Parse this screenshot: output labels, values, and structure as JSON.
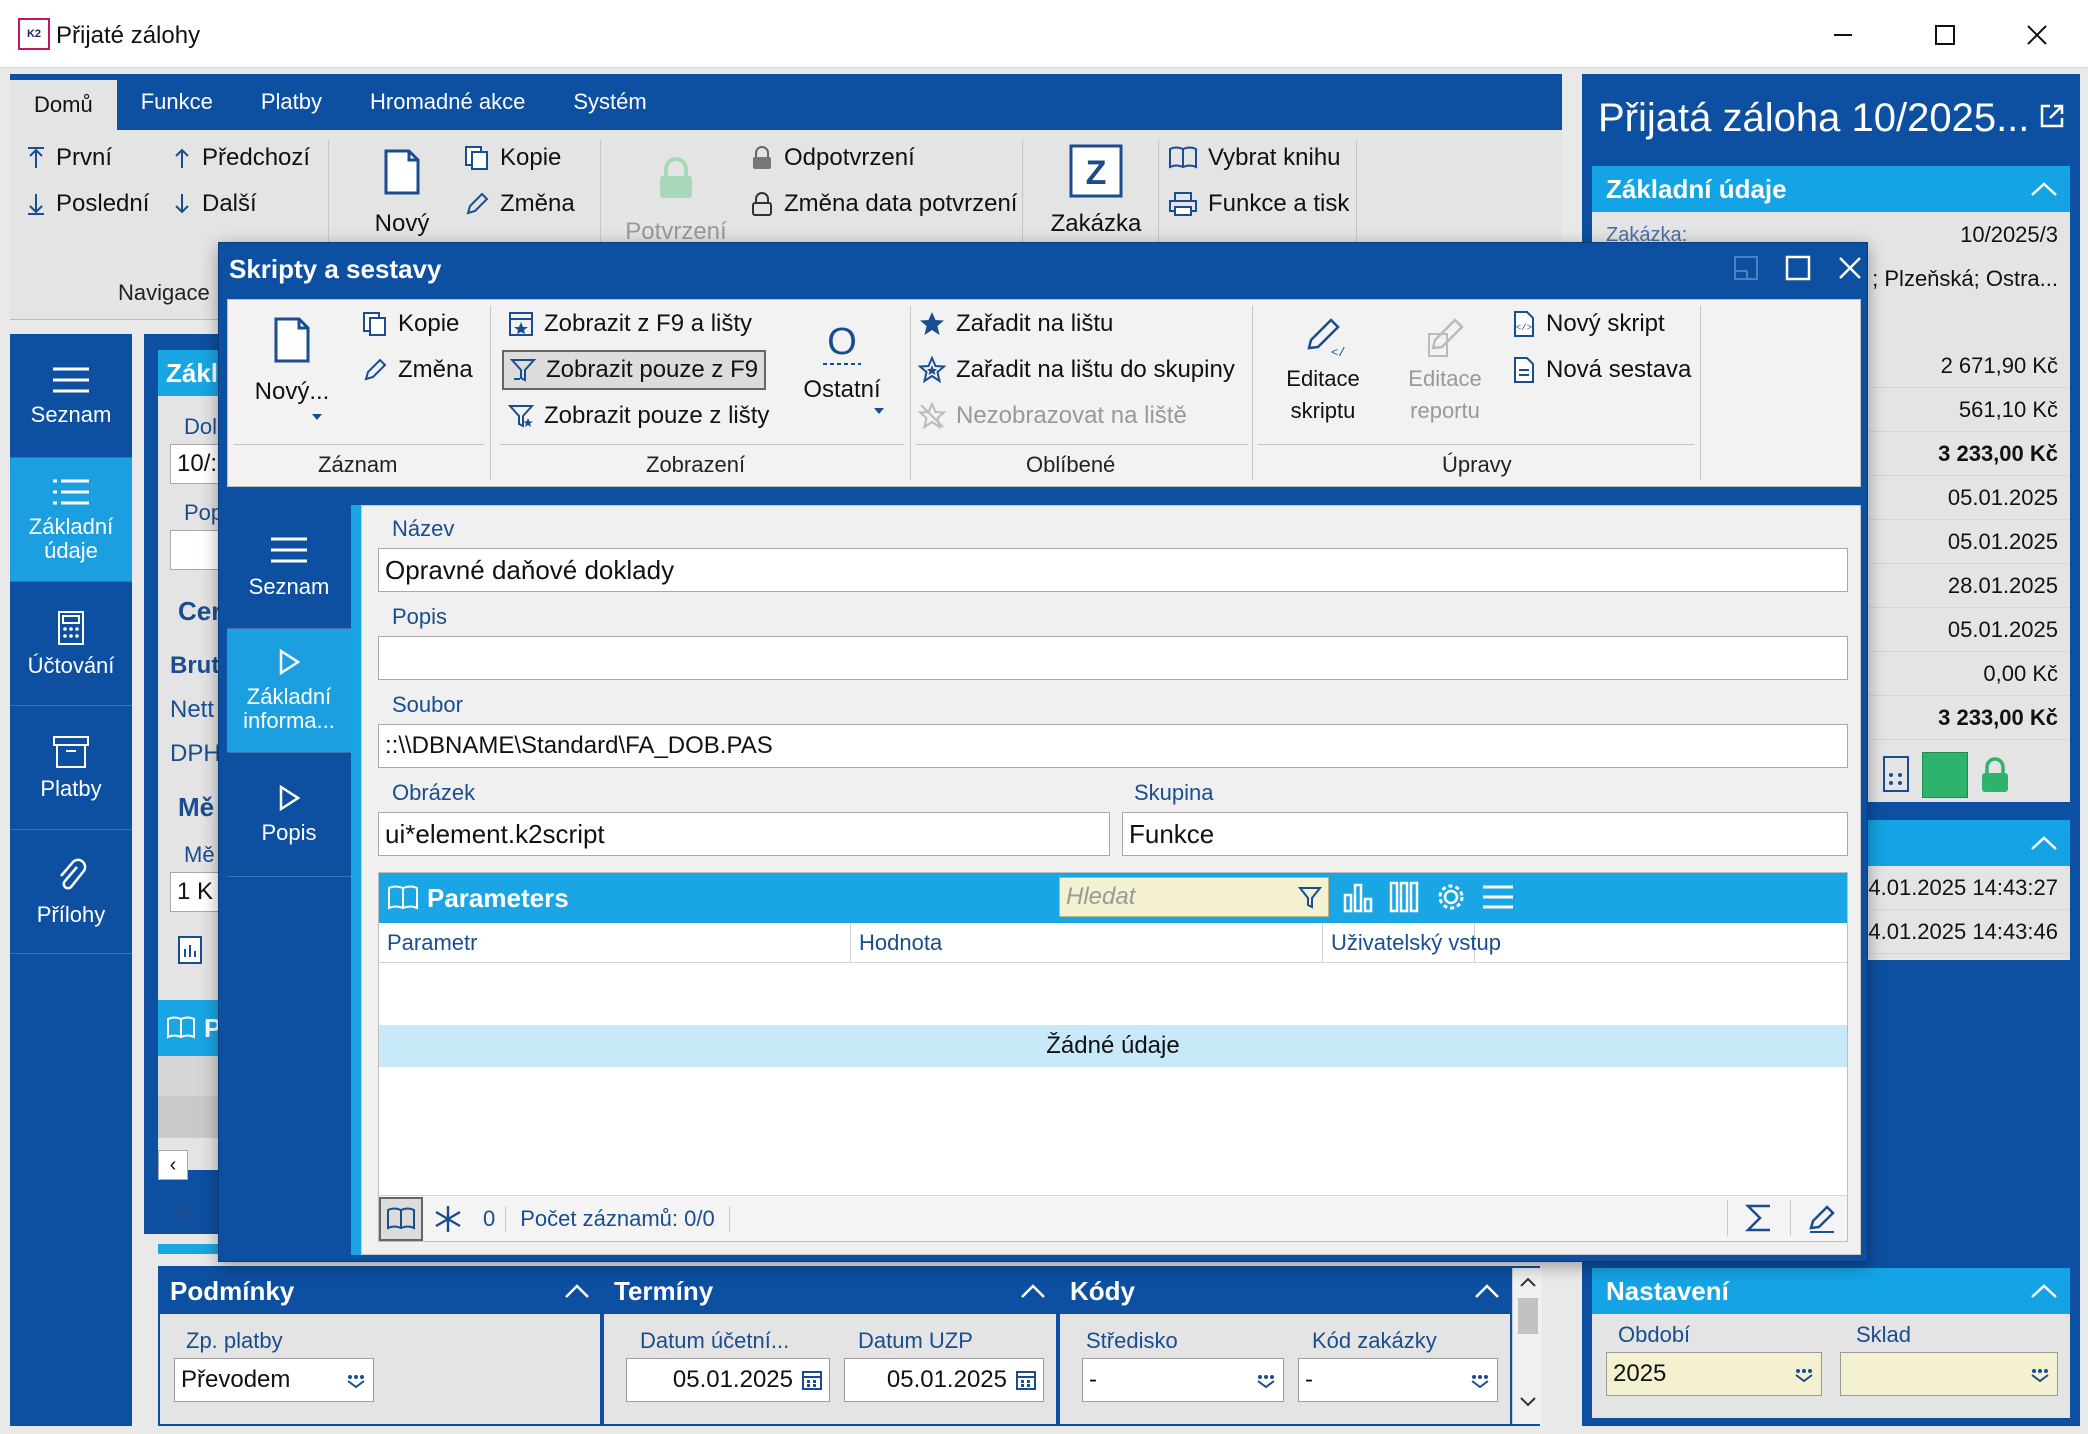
{
  "window": {
    "title": "Přijaté zálohy",
    "logo_text": "K2"
  },
  "main_ribbon": {
    "tabs": [
      "Domů",
      "Funkce",
      "Platby",
      "Hromadné akce",
      "Systém"
    ],
    "nav": {
      "first": "První",
      "prev": "Předchozí",
      "last": "Poslední",
      "next": "Další",
      "group_label": "Navigace"
    },
    "record": {
      "new": "Nový",
      "copy": "Kopie",
      "change": "Změna"
    },
    "confirm": {
      "confirm": "Potvrzení",
      "unconfirm": "Odpotvrzení",
      "change_date": "Změna data potvrzení"
    },
    "order": {
      "label": "Zakázka"
    },
    "book": {
      "choose_book": "Vybrat knihu",
      "functions_print": "Funkce a tisk"
    }
  },
  "left_nav": {
    "items": [
      {
        "label": "Seznam",
        "icon": "list-icon"
      },
      {
        "label": "Základní údaje",
        "icon": "list-icon"
      },
      {
        "label": "Účtování",
        "icon": "calculator-icon"
      },
      {
        "label": "Platby",
        "icon": "box-icon"
      },
      {
        "label": "Přílohy",
        "icon": "paperclip-icon"
      }
    ]
  },
  "main_content": {
    "basic_head": "Zákl",
    "doc_label": "Dol",
    "doc_value": "10/:",
    "pop_label": "Pop",
    "price_head": "Cer",
    "brutto": "Brut",
    "netto": "Nett",
    "dph": "DPH",
    "mena_head": "Mě",
    "mena_label": "Mě",
    "mena_value": "1 K",
    "param_head_short": "P"
  },
  "bottom": {
    "conditions": {
      "title": "Podmínky",
      "payment_label": "Zp. platby",
      "payment_value": "Převodem"
    },
    "terms": {
      "title": "Termíny",
      "acc_date_label": "Datum účetní...",
      "acc_date_value": "05.01.2025",
      "uzp_label": "Datum UZP",
      "uzp_value": "05.01.2025"
    },
    "codes": {
      "title": "Kódy",
      "center_label": "Středisko",
      "center_value": "-",
      "order_label": "Kód zakázky",
      "order_value": "-"
    }
  },
  "right_panel": {
    "title": "Přijatá záloha 10/2025...",
    "basic_title": "Základní údaje",
    "order_label": "Zakázka:",
    "order_value": "10/2025/3",
    "address": "; Plzeňská; Ostra...",
    "values": [
      "2 671,90 Kč",
      "561,10 Kč",
      "3 233,00 Kč",
      "05.01.2025",
      "05.01.2025",
      "28.01.2025",
      "05.01.2025",
      "0,00 Kč",
      "3 233,00 Kč"
    ],
    "timestamps": [
      "4.01.2025 14:43:27",
      "4.01.2025 14:43:46"
    ],
    "settings_title": "Nastavení",
    "period_label": "Období",
    "period_value": "2025",
    "store_label": "Sklad",
    "store_value": ""
  },
  "dialog": {
    "title": "Skripty a sestavy",
    "ribbon": {
      "new": "Nový...",
      "copy": "Kopie",
      "change": "Změna",
      "record_group": "Záznam",
      "show_f9_bar": "Zobrazit z F9 a lišty",
      "show_f9_only": "Zobrazit pouze z F9",
      "show_bar_only": "Zobrazit pouze z lišty",
      "other": "Ostatní",
      "display_group": "Zobrazení",
      "add_bar": "Zařadit na lištu",
      "add_bar_group": "Zařadit na lištu do skupiny",
      "hide_bar": "Nezobrazovat na liště",
      "favorites_group": "Oblíbené",
      "edit_script_1": "Editace",
      "edit_script_2": "skriptu",
      "edit_report_1": "Editace",
      "edit_report_2": "reportu",
      "new_script": "Nový skript",
      "new_report": "Nová sestava",
      "edits_group": "Úpravy"
    },
    "nav": [
      "Seznam",
      "Základní informa...",
      "Popis"
    ],
    "form": {
      "name_label": "Název",
      "name_value": "Opravné daňové doklady",
      "desc_label": "Popis",
      "desc_value": "",
      "file_label": "Soubor",
      "file_value": "::\\\\DBNAME\\Standard\\FA_DOB.PAS",
      "image_label": "Obrázek",
      "image_value": "ui*element.k2script",
      "group_label": "Skupina",
      "group_value": "Funkce"
    },
    "params": {
      "title": "Parameters",
      "search_placeholder": "Hledat",
      "columns": [
        "Parametr",
        "Hodnota",
        "Uživatelský vstup"
      ],
      "empty_text": "Žádné údaje",
      "filter_count": "0",
      "record_count": "Počet záznamů: 0/0"
    }
  },
  "colors": {
    "brand_blue": "#0d4fa0",
    "accent_cyan": "#1aa6e4",
    "confirm_green": "#2db36b"
  }
}
